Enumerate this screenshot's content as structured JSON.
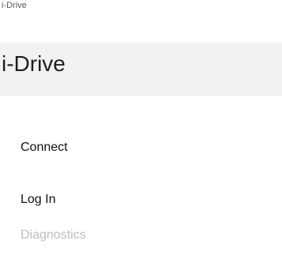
{
  "window": {
    "title": "i-Drive"
  },
  "header": {
    "title": "i-Drive"
  },
  "menu": {
    "items": [
      {
        "label": "Connect",
        "enabled": true
      },
      {
        "label": "Log In",
        "enabled": true
      },
      {
        "label": "Diagnostics",
        "enabled": false
      }
    ]
  },
  "colors": {
    "header_bg": "#f2f2f2",
    "text": "#111111",
    "disabled_text": "#bdbdbd"
  }
}
